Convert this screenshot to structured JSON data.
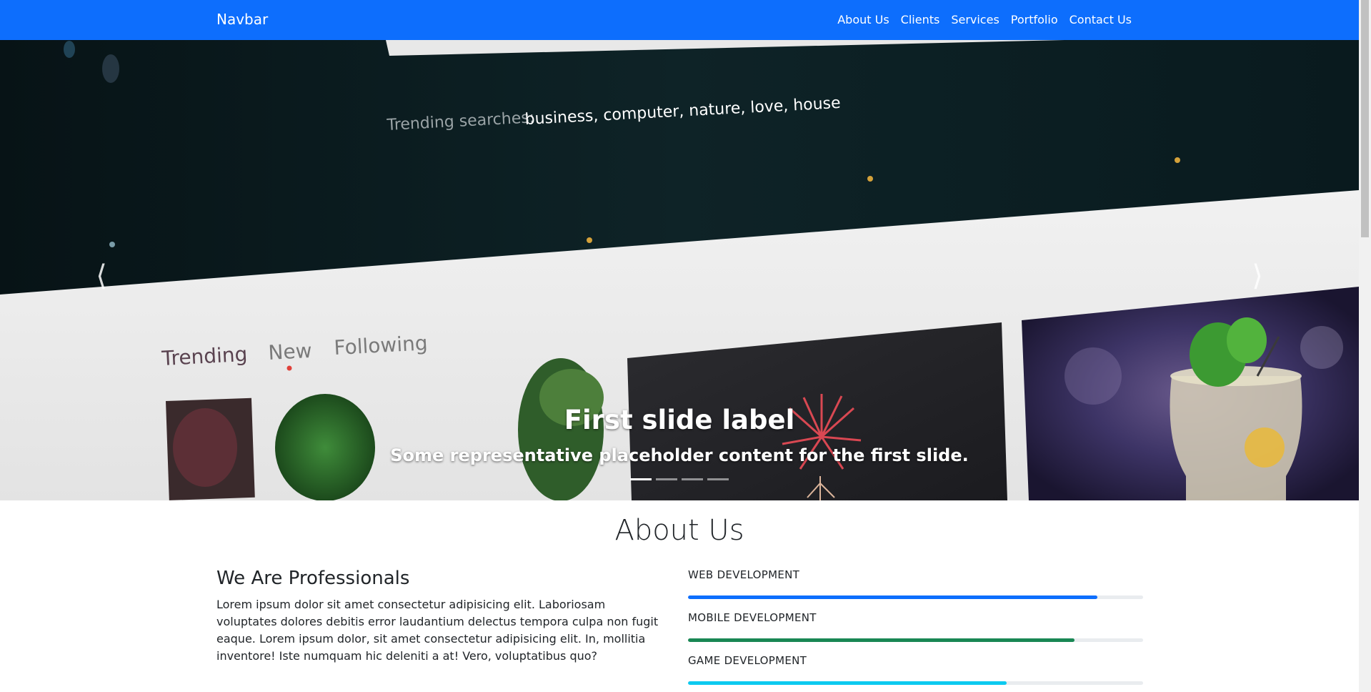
{
  "navbar": {
    "brand": "Navbar",
    "links": [
      "About Us",
      "Clients",
      "Services",
      "Portfolio",
      "Contact Us"
    ]
  },
  "carousel": {
    "photo_text": {
      "trending_label": "Trending searches:",
      "trending_terms": "business, computer, nature, love, house",
      "tabs": [
        "Trending",
        "New",
        "Following"
      ]
    },
    "caption_title": "First slide label",
    "caption_text": "Some representative placeholder content for the first slide.",
    "indicator_count": 4,
    "active_indicator": 0,
    "prev_icon": "chevron-left-icon",
    "next_icon": "chevron-right-icon"
  },
  "about": {
    "title": "About Us",
    "heading": "We Are Professionals",
    "text": "Lorem ipsum dolor sit amet consectetur adipisicing elit. Laboriosam voluptates dolores debitis error laudantium delectus tempora culpa non fugit eaque. Lorem ipsum dolor, sit amet consectetur adipisicing elit. In, mollitia inventore! Iste numquam hic deleniti a at! Vero, voluptatibus quo?",
    "skills": [
      {
        "label": "WEB DEVELOPMENT",
        "percent": 90,
        "color": "#0d6efd"
      },
      {
        "label": "MOBILE DEVELOPMENT",
        "percent": 85,
        "color": "#198754"
      },
      {
        "label": "GAME DEVELOPMENT",
        "percent": 70,
        "color": "#0dcaf0"
      }
    ]
  },
  "colors": {
    "primary": "#0d6efd",
    "success": "#198754",
    "info": "#0dcaf0"
  }
}
